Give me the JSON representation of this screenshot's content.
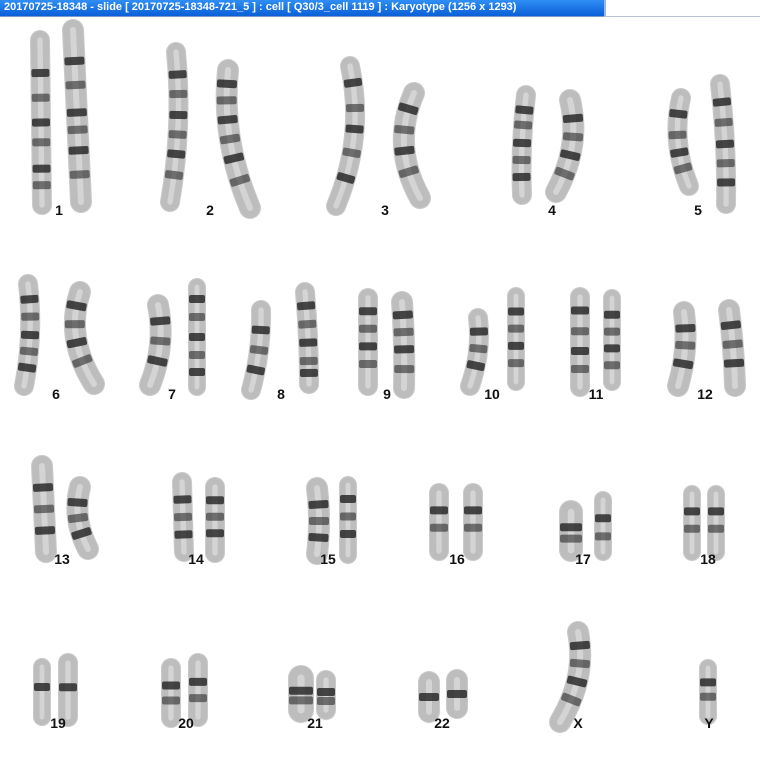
{
  "window": {
    "title": "20170725-18348 - slide [ 20170725-18348-721_5 ] : cell [ Q30/3_cell 1119 ] : Karyotype  (1256 x 1293)"
  },
  "colors": {
    "titlebar": "#0a5fd6",
    "title_text": "#ffffff",
    "chromosome_base": "#bdbdbd",
    "band_dark": "#2a2a2a",
    "label": "#111111"
  },
  "karyotype": {
    "labels": [
      "1",
      "2",
      "3",
      "4",
      "5",
      "6",
      "7",
      "8",
      "9",
      "10",
      "11",
      "12",
      "13",
      "14",
      "15",
      "16",
      "17",
      "18",
      "19",
      "20",
      "21",
      "22",
      "X",
      "Y"
    ]
  }
}
